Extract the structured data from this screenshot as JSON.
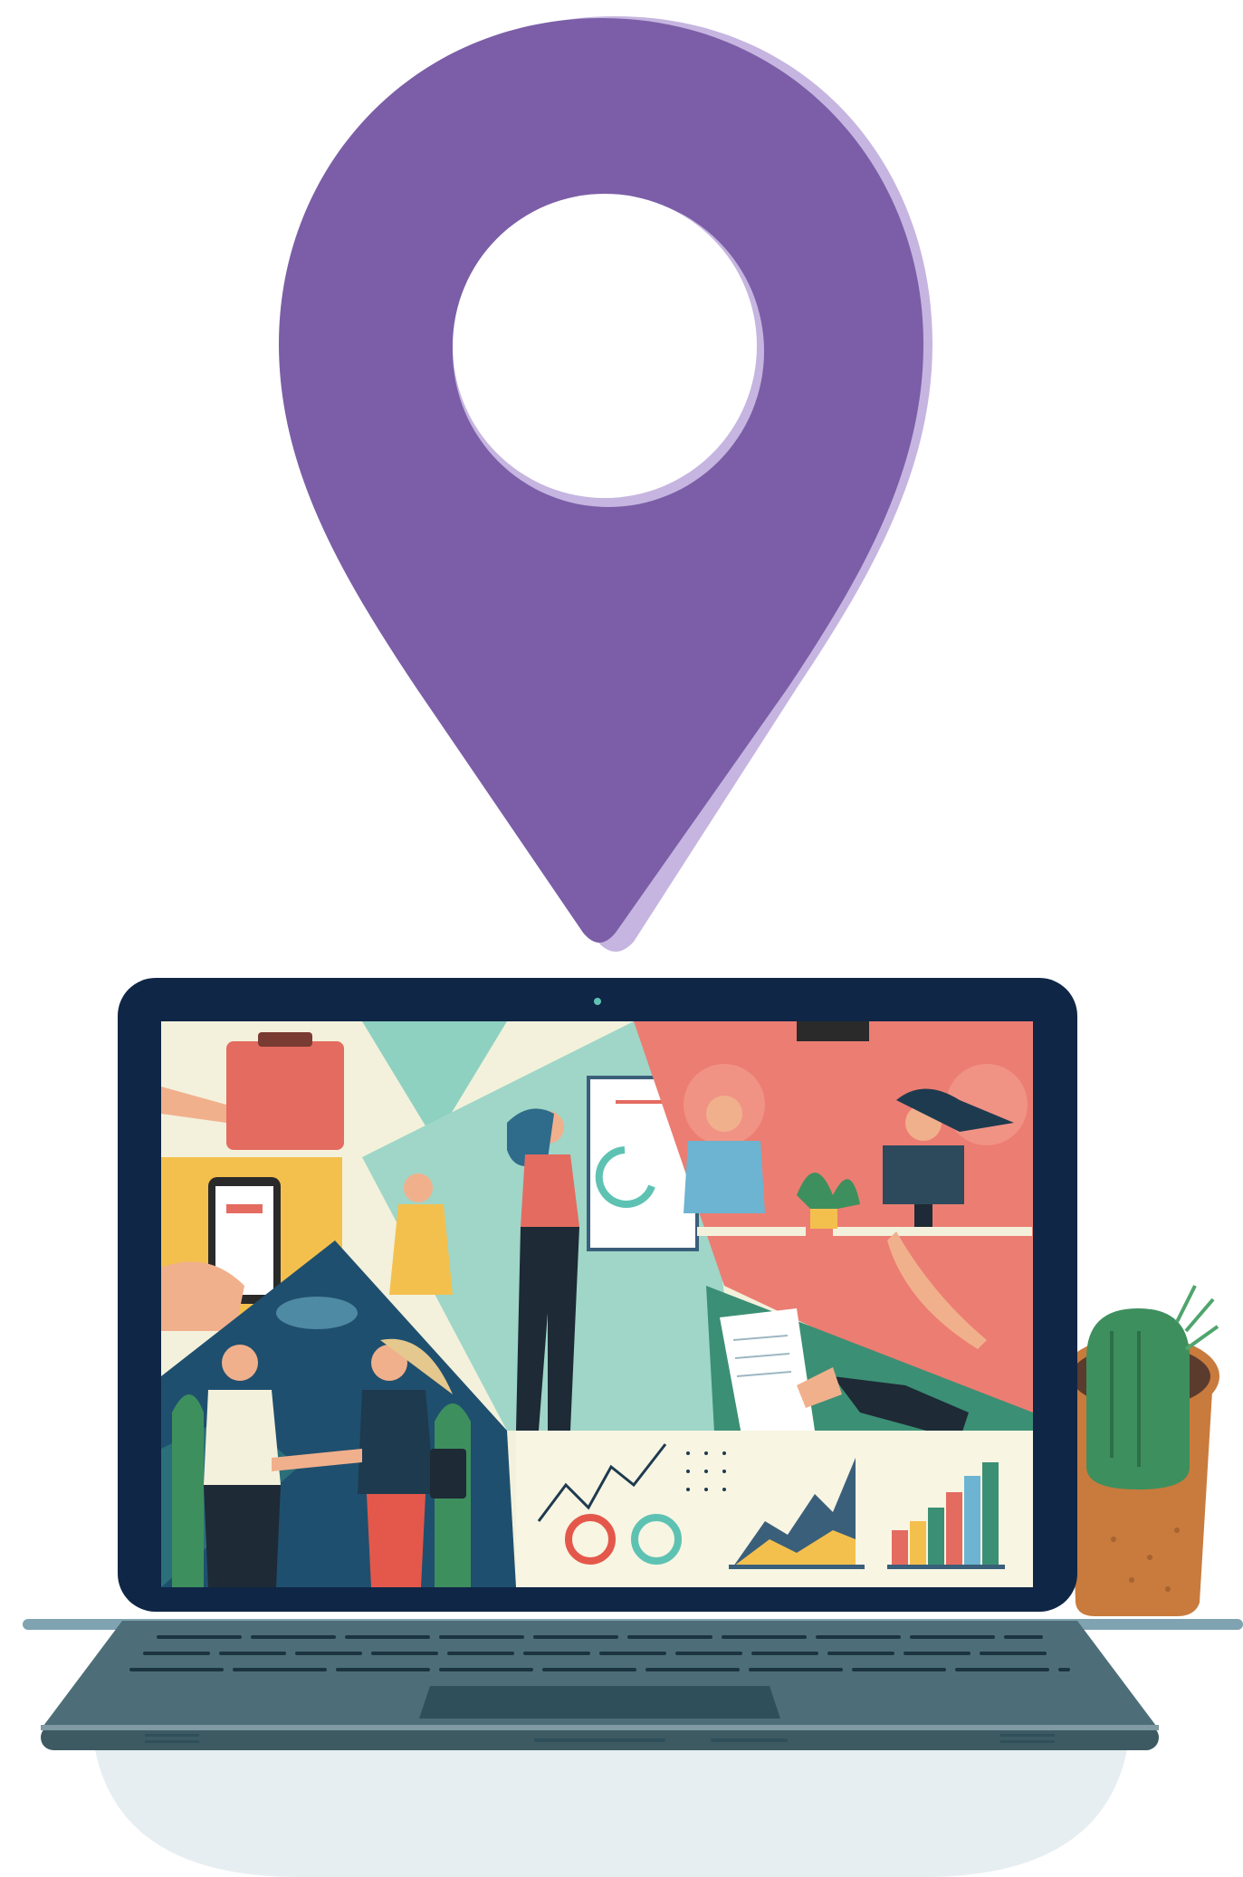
{
  "illustration": {
    "pin_icon": "map-pin-icon",
    "device": "laptop",
    "plant": "cactus-in-pot",
    "colors": {
      "pin": "#7b5ea7",
      "pin_shadow": "#c6b5e0",
      "laptop_bezel": "#0f2646",
      "laptop_base": "#4d6e78",
      "keyboard_keys": "#1b3440",
      "shadow": "#e7eef1",
      "desk_line": "#7fa3b0",
      "pot": "#c87b3d",
      "cactus": "#3e8f5e"
    },
    "screen_panels": [
      "handing-package",
      "phone-in-hand",
      "presenter-at-whiteboard",
      "office-workers-at-desks",
      "signing-document",
      "business-handshake",
      "analytics-charts"
    ]
  }
}
